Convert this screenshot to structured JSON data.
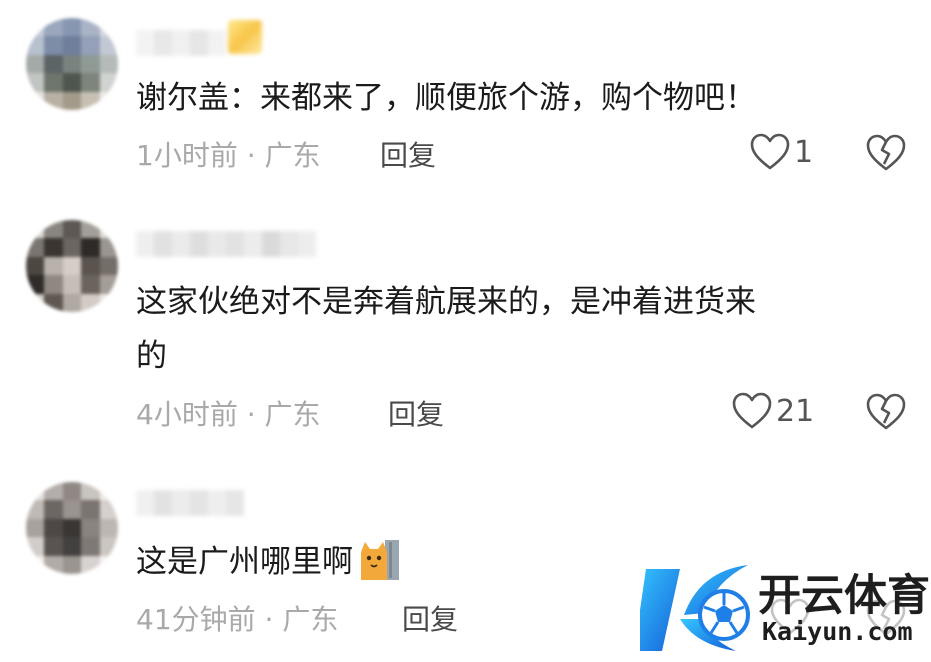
{
  "comments": [
    {
      "text": "谢尔盖：来都来了，顺便旅个游，购个物吧！",
      "time_location": "1小时前 · 广东",
      "reply_label": "回复",
      "like_count": "1"
    },
    {
      "text_line1": "这家伙绝对不是奔着航展来的，是冲着进货来",
      "text_line2": "的",
      "time_location": "4小时前 · 广东",
      "reply_label": "回复",
      "like_count": "21"
    },
    {
      "text": "这是广州哪里啊",
      "time_location": "41分钟前 · 广东",
      "reply_label": "回复",
      "like_count": ""
    }
  ],
  "watermark": {
    "title": "开云体育",
    "subtitle": "Kaiyun.com"
  },
  "icons": {
    "like": "heart-outline-icon",
    "dislike": "broken-heart-icon",
    "emoji": "cat-peek-emoji-icon",
    "logo": "k-soccer-ball-logo"
  },
  "colors": {
    "meta_text": "#a9a9a9",
    "logo_blue": "#1f7fe8"
  }
}
